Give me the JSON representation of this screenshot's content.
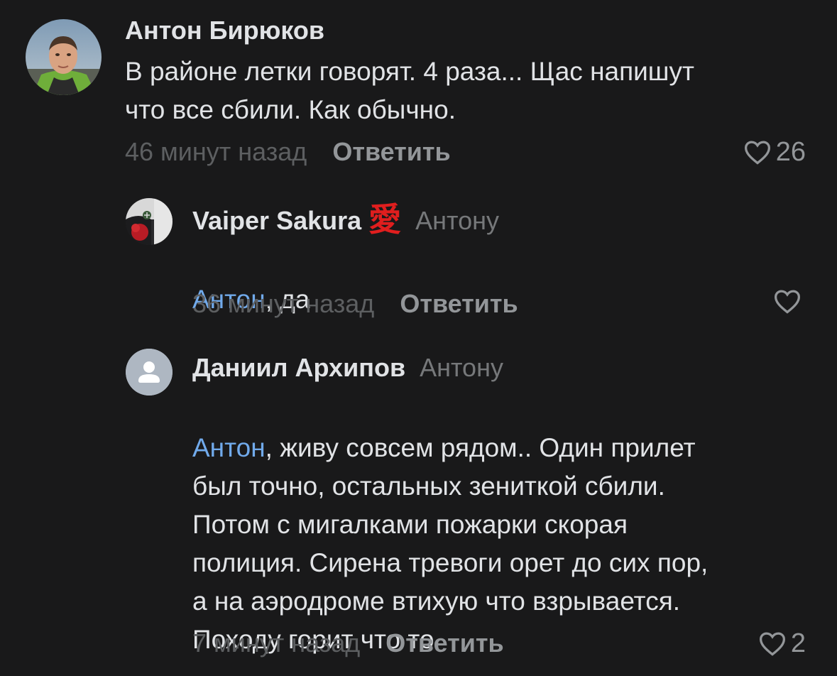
{
  "comments": [
    {
      "author": "Антон Бирюков",
      "text": "В районе летки говорят. 4 раза... Щас напишут\nчто все сбили. Как обычно.",
      "time": "46 минут назад",
      "reply_label": "Ответить",
      "likes": "26",
      "avatar_icon": "user-photo"
    },
    {
      "author": "Vaiper Sakura",
      "author_badge": "愛",
      "reply_to": "Антону",
      "mention": "Антон",
      "text": ", да",
      "time": "36 минут назад",
      "reply_label": "Ответить",
      "likes": "",
      "avatar_icon": "user-photo"
    },
    {
      "author": "Даниил Архипов",
      "reply_to": "Антону",
      "mention": "Антон",
      "text": ", живу совсем рядом.. Один прилет\nбыл точно, остальных зениткой сбили.\nПотом с мигалками пожарки скорая\nполиция. Сирена тревоги орет до сих пор,\nа на аэродроме втихую что взрывается.\nПоходу горит что то",
      "time": "7 минут назад",
      "reply_label": "Ответить",
      "likes": "2",
      "avatar_icon": "default-user-icon"
    }
  ],
  "colors": {
    "background": "#19191a",
    "text": "#e1e3e6",
    "secondary": "#76787a",
    "mention": "#71aaeb",
    "badge": "#e01e1e"
  }
}
